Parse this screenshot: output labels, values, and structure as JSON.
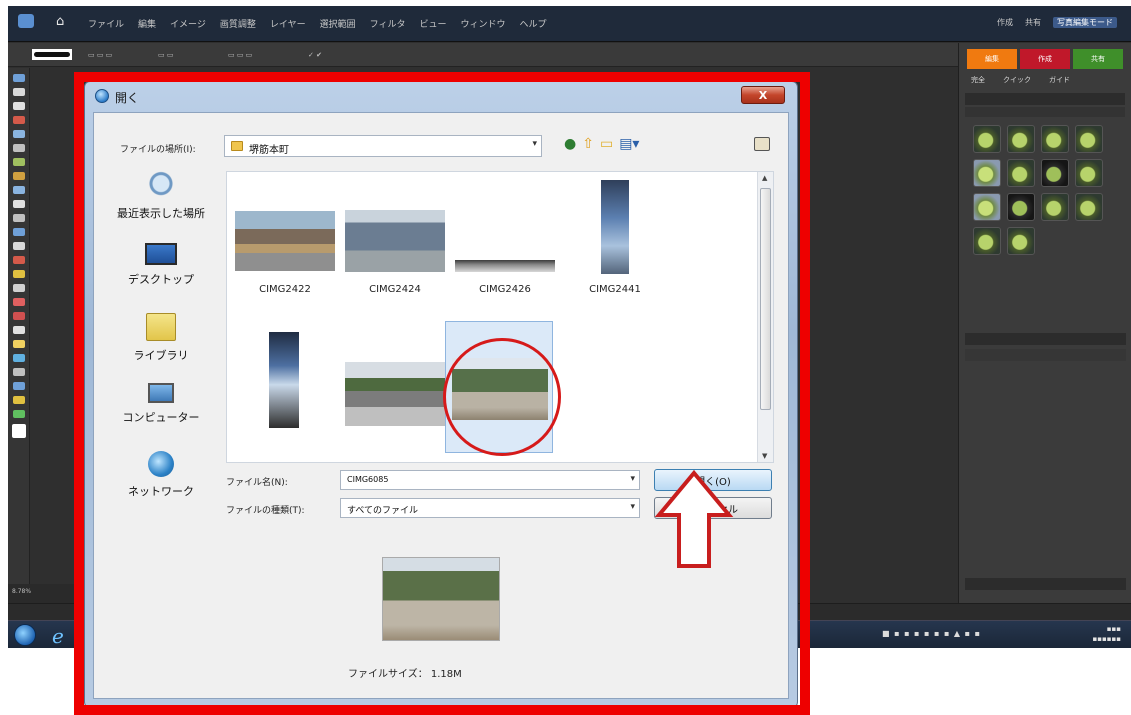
{
  "app": {
    "menu": [
      "ファイル",
      "編集",
      "イメージ",
      "画質調整",
      "レイヤー",
      "選択範囲",
      "フィルタ",
      "ビュー",
      "ウィンドウ",
      "ヘルプ"
    ],
    "right_menu": [
      "作成",
      "共有",
      "写真編集モード"
    ],
    "mode_tabs": [
      "編集",
      "作成",
      "共有"
    ],
    "mode_tab_colors": [
      "#f07a10",
      "#c0182a",
      "#3f8f2a"
    ],
    "sub_tabs": [
      "完全",
      "クイック",
      "ガイド"
    ],
    "status_text": "8.78%"
  },
  "dialog": {
    "title": "開く",
    "close_label": "X",
    "lookin_label": "ファイルの場所(I):",
    "lookin_value": "堺筋本町",
    "places": [
      {
        "label": "最近表示した場所",
        "icon": "recent-places-icon"
      },
      {
        "label": "デスクトップ",
        "icon": "desktop-icon"
      },
      {
        "label": "ライブラリ",
        "icon": "library-icon"
      },
      {
        "label": "コンピューター",
        "icon": "computer-icon"
      },
      {
        "label": "ネットワーク",
        "icon": "network-icon"
      }
    ],
    "files": [
      {
        "name": "CIMG2422"
      },
      {
        "name": "CIMG2424"
      },
      {
        "name": "CIMG2426"
      },
      {
        "name": "CIMG2441"
      },
      {
        "name": ""
      },
      {
        "name": ""
      },
      {
        "name": ""
      }
    ],
    "selected_index": 6,
    "filename_label": "ファイル名(N):",
    "filename_value": "CIMG6085",
    "filetype_label": "ファイルの種類(T):",
    "filetype_value": "すべてのファイル",
    "open_label": "開く(O)",
    "cancel_label": "キャンセル",
    "filesize_text": "ファイルサイズ： 1.18M"
  },
  "annotation": {
    "frame_color": "#ee0000",
    "circle_color": "#d61a1a",
    "arrow_color": "#c81e1e"
  }
}
